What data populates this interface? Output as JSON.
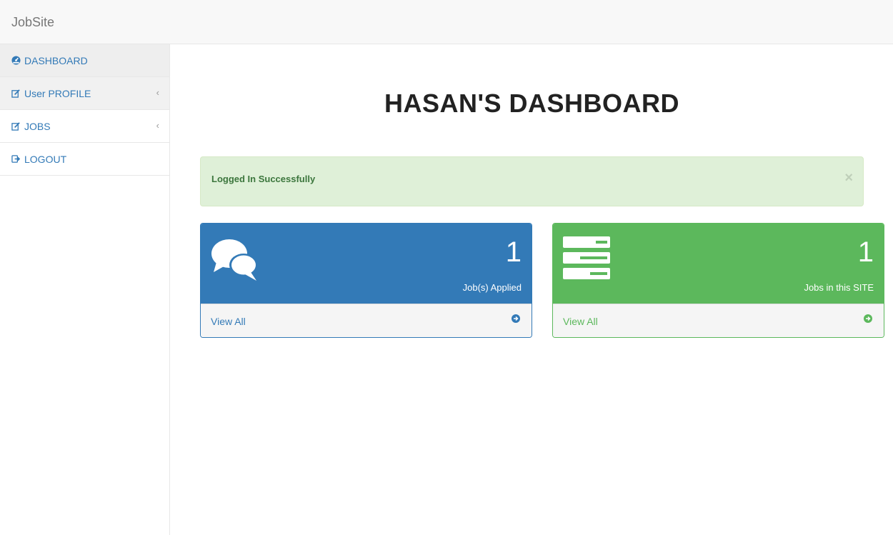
{
  "navbar": {
    "brand": "JobSite"
  },
  "sidebar": {
    "items": [
      {
        "label": "DASHBOARD",
        "icon": "dashboard-icon"
      },
      {
        "label": "User PROFILE",
        "icon": "edit-icon",
        "has_arrow": true
      },
      {
        "label": "JOBS",
        "icon": "edit-icon",
        "has_arrow": true
      },
      {
        "label": "LOGOUT",
        "icon": "logout-icon"
      }
    ]
  },
  "main": {
    "title": "HASAN'S DASHBOARD",
    "alert": {
      "message": "Logged In Successfully",
      "close": "×"
    },
    "panels": [
      {
        "count": "1",
        "label": "Job(s) Applied",
        "link": "View All",
        "color": "#337ab7",
        "icon": "comments-icon"
      },
      {
        "count": "1",
        "label": "Jobs in this SITE",
        "link": "View All",
        "color": "#5cb85c",
        "icon": "server-icon"
      }
    ]
  }
}
